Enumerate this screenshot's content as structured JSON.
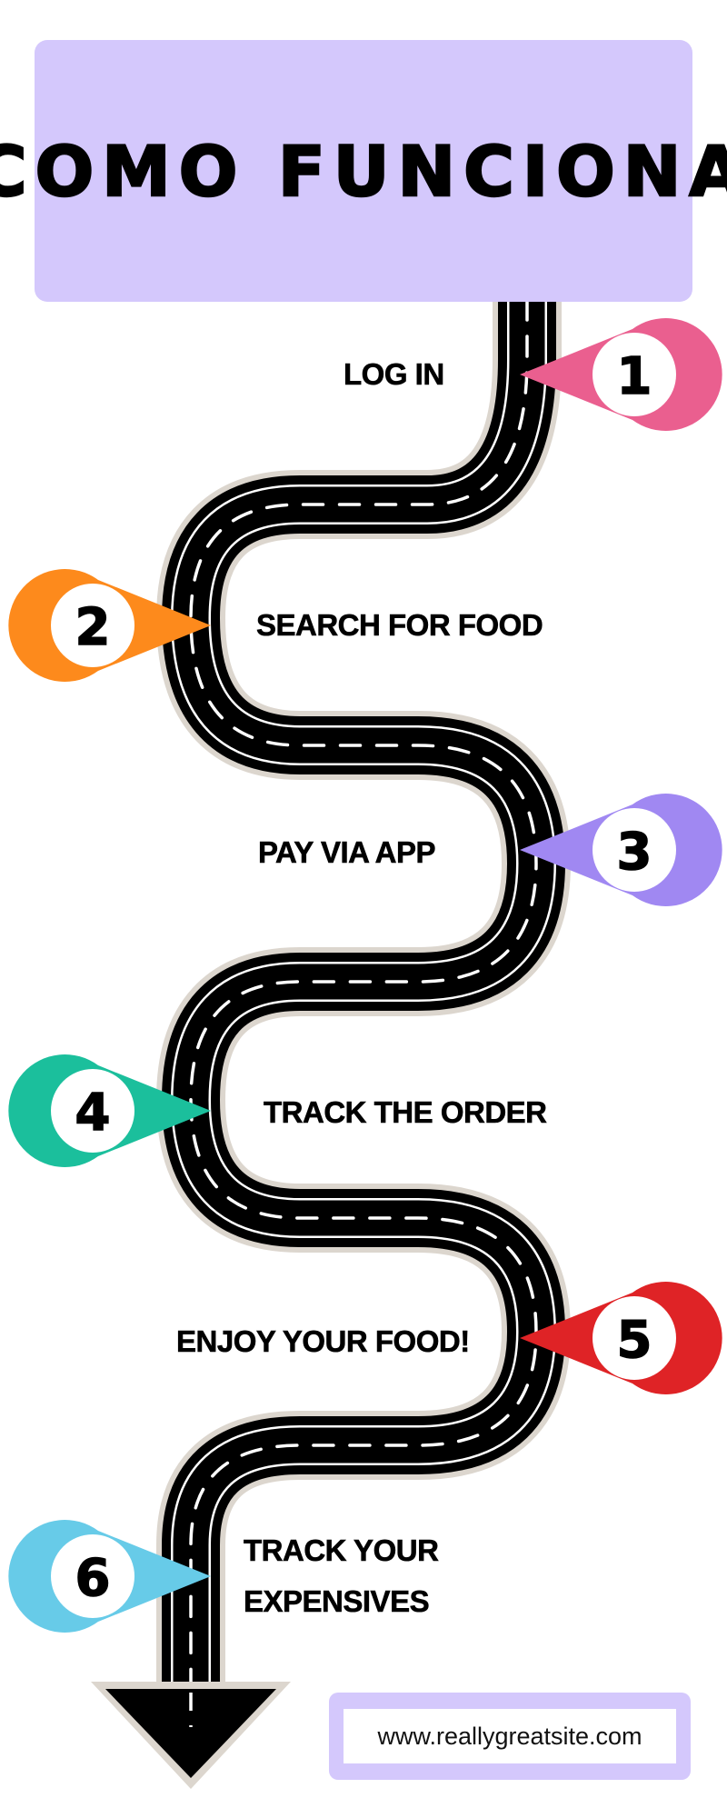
{
  "header": {
    "title": "COMO FUNCIONA"
  },
  "steps": [
    {
      "number": "1",
      "label": "LOG IN",
      "color": "#ea5f8f"
    },
    {
      "number": "2",
      "label": "SEARCH FOR FOOD",
      "color": "#fd8a1c"
    },
    {
      "number": "3",
      "label": "PAY VIA APP",
      "color": "#a088f2"
    },
    {
      "number": "4",
      "label": "TRACK THE ORDER",
      "color": "#1bbf9c"
    },
    {
      "number": "5",
      "label": "ENJOY YOUR FOOD!",
      "color": "#df2326"
    },
    {
      "number": "6",
      "label_line1": "TRACK YOUR",
      "label_line2": "EXPENSIVES",
      "color": "#67cbe8"
    }
  ],
  "footer": {
    "website": "www.reallygreatsite.com"
  },
  "colors": {
    "title_background": "#d4c8fc",
    "road": "#000000",
    "road_edge": "#dcd6ce",
    "road_dash": "#ffffff"
  }
}
